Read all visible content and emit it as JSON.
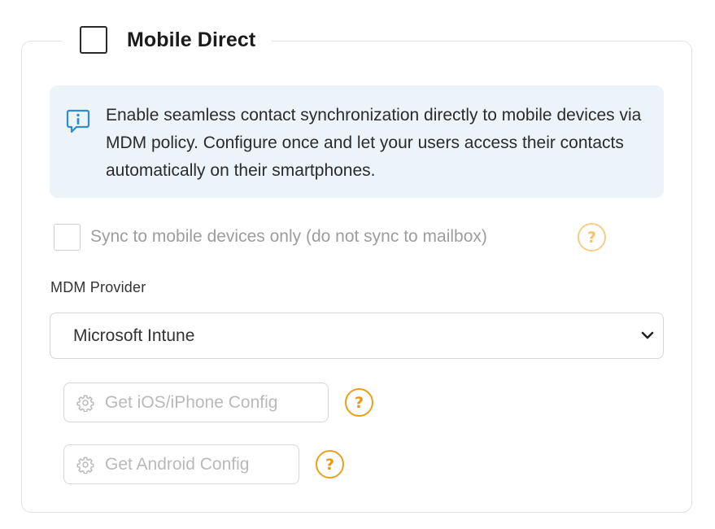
{
  "section": {
    "title": "Mobile Direct",
    "enabled": false
  },
  "info": {
    "icon": "info-icon",
    "text": "Enable seamless contact synchronization directly to mobile devices via MDM policy. Configure once and let your users access their contacts automatically on their smartphones."
  },
  "sync_option": {
    "label": "Sync to mobile devices only (do not sync to mailbox)",
    "checked": false,
    "disabled": true,
    "help_symbol": "?"
  },
  "mdm": {
    "label": "MDM Provider",
    "selected": "Microsoft Intune"
  },
  "buttons": {
    "ios": {
      "label": "Get iOS/iPhone Config",
      "icon": "gear-icon",
      "help_symbol": "?"
    },
    "android": {
      "label": "Get Android Config",
      "icon": "gear-icon",
      "help_symbol": "?"
    }
  },
  "colors": {
    "info_background": "#ecf3f9",
    "info_icon": "#2d8fd1",
    "help_accent": "#ec9f17",
    "disabled_text": "#b9b9b9"
  }
}
